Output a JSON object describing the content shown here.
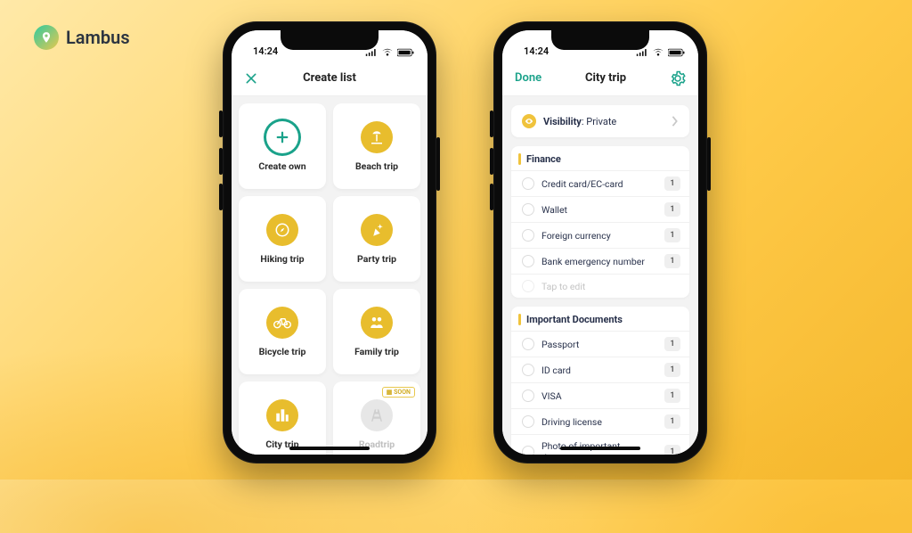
{
  "brand": {
    "name": "Lambus"
  },
  "clock": "14:24",
  "left_phone": {
    "nav": {
      "close_icon": "×",
      "title": "Create list"
    },
    "cards": [
      {
        "label": "Create own",
        "icon": "plus",
        "icon_bg": "#ffffff",
        "icon_ring": "#1aa28a",
        "icon_fg": "#1aa28a",
        "interactable": true
      },
      {
        "label": "Beach trip",
        "icon": "beach",
        "icon_bg": "#e8bd2d",
        "icon_fg": "#ffffff",
        "interactable": true
      },
      {
        "label": "Hiking trip",
        "icon": "compass",
        "icon_bg": "#e8bd2d",
        "icon_fg": "#ffffff",
        "interactable": true
      },
      {
        "label": "Party trip",
        "icon": "party",
        "icon_bg": "#e8bd2d",
        "icon_fg": "#ffffff",
        "interactable": true
      },
      {
        "label": "Bicycle trip",
        "icon": "bike",
        "icon_bg": "#e8bd2d",
        "icon_fg": "#ffffff",
        "interactable": true
      },
      {
        "label": "Family trip",
        "icon": "family",
        "icon_bg": "#e8bd2d",
        "icon_fg": "#ffffff",
        "interactable": true
      },
      {
        "label": "City trip",
        "icon": "city",
        "icon_bg": "#e8bd2d",
        "icon_fg": "#ffffff",
        "interactable": true
      },
      {
        "label": "Roadtrip",
        "icon": "road",
        "icon_bg": "#e7e7e7",
        "icon_fg": "#cfcfcf",
        "interactable": false,
        "soon": "SOON"
      }
    ]
  },
  "right_phone": {
    "nav": {
      "done": "Done",
      "title": "City trip"
    },
    "visibility": {
      "label": "Visibility",
      "value": "Private"
    },
    "sections": [
      {
        "title": "Finance",
        "items": [
          {
            "text": "Credit card/EC-card",
            "count": "1"
          },
          {
            "text": "Wallet",
            "count": "1"
          },
          {
            "text": "Foreign currency",
            "count": "1"
          },
          {
            "text": "Bank emergency number",
            "count": "1"
          }
        ],
        "placeholder": "Tap to edit"
      },
      {
        "title": "Important Documents",
        "items": [
          {
            "text": "Passport",
            "count": "1"
          },
          {
            "text": "ID card",
            "count": "1"
          },
          {
            "text": "VISA",
            "count": "1"
          },
          {
            "text": "Driving license",
            "count": "1"
          },
          {
            "text": "Photo of important documents",
            "count": "1"
          }
        ]
      }
    ]
  }
}
